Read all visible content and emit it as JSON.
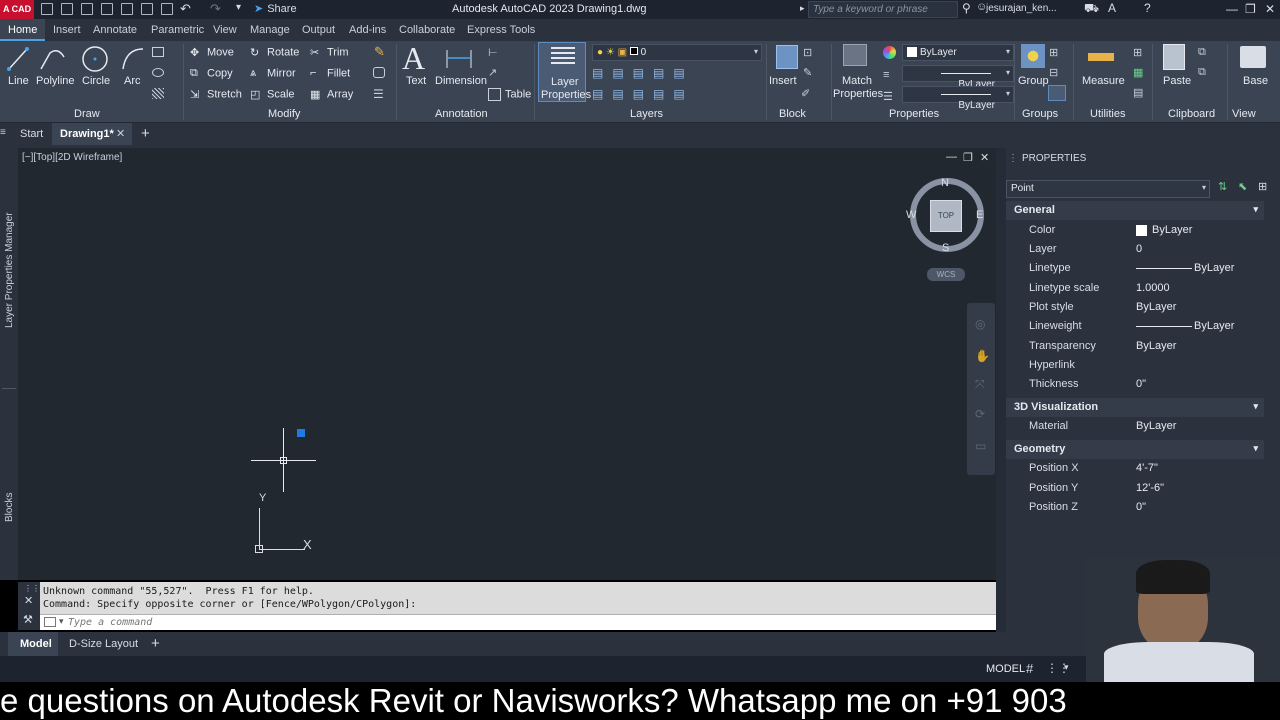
{
  "titlebar": {
    "logo": "A CAD",
    "share": "Share",
    "title": "Autodesk AutoCAD 2023    Drawing1.dwg",
    "search_placeholder": "Type a keyword or phrase",
    "user": "jesurajan_ken..."
  },
  "ribbon_tabs": [
    "Home",
    "Insert",
    "Annotate",
    "Parametric",
    "View",
    "Manage",
    "Output",
    "Add-ins",
    "Collaborate",
    "Express Tools"
  ],
  "draw": {
    "line": "Line",
    "polyline": "Polyline",
    "circle": "Circle",
    "arc": "Arc",
    "title": "Draw"
  },
  "modify": {
    "move": "Move",
    "rotate": "Rotate",
    "trim": "Trim",
    "copy": "Copy",
    "mirror": "Mirror",
    "fillet": "Fillet",
    "stretch": "Stretch",
    "scale": "Scale",
    "array": "Array",
    "title": "Modify"
  },
  "annotation": {
    "text": "Text",
    "dimension": "Dimension",
    "table": "Table",
    "title": "Annotation"
  },
  "layers": {
    "layer_properties_1": "Layer",
    "layer_properties_2": "Properties",
    "current_layer": "0",
    "title": "Layers"
  },
  "block": {
    "insert": "Insert",
    "title": "Block"
  },
  "properties_panel": {
    "match_1": "Match",
    "match_2": "Properties",
    "color": "ByLayer",
    "linetype": "ByLayer",
    "lineweight": "ByLayer",
    "title": "Properties"
  },
  "groups": {
    "group": "Group",
    "title": "Groups"
  },
  "utilities": {
    "measure": "Measure",
    "title": "Utilities"
  },
  "clipboard": {
    "paste": "Paste",
    "title": "Clipboard"
  },
  "view_panel": {
    "base": "Base",
    "title": "View"
  },
  "doc_tabs": {
    "start": "Start",
    "drawing": "Drawing1*"
  },
  "viewport": {
    "label": "[−][Top][2D Wireframe]"
  },
  "viewcube": {
    "n": "N",
    "s": "S",
    "e": "E",
    "w": "W",
    "top": "TOP",
    "wcs": "WCS"
  },
  "ucs": {
    "x": "X",
    "y": "Y"
  },
  "side_palettes": {
    "layer_manager": "Layer Properties Manager",
    "blocks": "Blocks"
  },
  "properties": {
    "header": "PROPERTIES",
    "selection": "Point",
    "general": {
      "title": "General",
      "rows": [
        {
          "label": "Color",
          "value": "ByLayer"
        },
        {
          "label": "Layer",
          "value": "0"
        },
        {
          "label": "Linetype",
          "value": "ByLayer"
        },
        {
          "label": "Linetype scale",
          "value": "1.0000"
        },
        {
          "label": "Plot style",
          "value": "ByLayer"
        },
        {
          "label": "Lineweight",
          "value": "ByLayer"
        },
        {
          "label": "Transparency",
          "value": "ByLayer"
        },
        {
          "label": "Hyperlink",
          "value": ""
        },
        {
          "label": "Thickness",
          "value": "0\""
        }
      ]
    },
    "viz": {
      "title": "3D Visualization",
      "rows": [
        {
          "label": "Material",
          "value": "ByLayer"
        }
      ]
    },
    "geometry": {
      "title": "Geometry",
      "rows": [
        {
          "label": "Position X",
          "value": "4'-7\""
        },
        {
          "label": "Position Y",
          "value": "12'-6\""
        },
        {
          "label": "Position Z",
          "value": "0\""
        }
      ]
    }
  },
  "command": {
    "line1": "Unknown command \"55,527\".  Press F1 for help.",
    "line2": "Command: Specify opposite corner or [Fence/WPolygon/CPolygon]:",
    "placeholder": "Type a command"
  },
  "layout_tabs": {
    "model": "Model",
    "layout": "D-Size Layout"
  },
  "status": {
    "model": "MODEL"
  },
  "banner": "e questions on Autodesk Revit or Navisworks?  Whatsapp me on +91 903",
  "colors": {
    "accent": "#4aa3e8",
    "canvas": "#212830",
    "ribbon": "#3b4453",
    "logo": "#c8102e"
  }
}
